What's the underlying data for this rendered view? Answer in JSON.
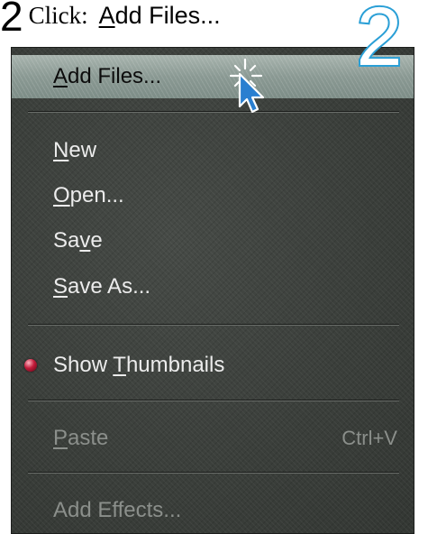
{
  "instruction": {
    "step_number": "2",
    "verb": "Click:",
    "target_prefix": "A",
    "target_rest": "dd Files..."
  },
  "badge": {
    "number": "2",
    "color": "#2a9fd6"
  },
  "menu": {
    "items": [
      {
        "pre": "",
        "mnemonic": "A",
        "post": "dd Files...",
        "state": "highlighted"
      },
      {
        "pre": "",
        "mnemonic": "N",
        "post": "ew",
        "state": "enabled"
      },
      {
        "pre": "",
        "mnemonic": "O",
        "post": "pen...",
        "state": "enabled"
      },
      {
        "pre": "Sa",
        "mnemonic": "v",
        "post": "e",
        "state": "enabled"
      },
      {
        "pre": "",
        "mnemonic": "S",
        "post": "ave As...",
        "state": "enabled"
      },
      {
        "pre": "Show ",
        "mnemonic": "T",
        "post": "humbnails",
        "state": "checked"
      },
      {
        "pre": "",
        "mnemonic": "P",
        "post": "aste",
        "shortcut": "Ctrl+V",
        "state": "disabled"
      },
      {
        "pre": "",
        "mnemonic": "",
        "post": "Add Effects...",
        "state": "disabled"
      }
    ]
  },
  "colors": {
    "menu_background": "#3a3e3a",
    "highlight": "#8a9993",
    "check_dot": "#c21b3a",
    "enabled_text": "#ececec",
    "disabled_text": "#8b8f8b"
  },
  "icons": [
    "mouse-pointer-icon",
    "click-sparkle-icon",
    "check-bullet-icon"
  ]
}
